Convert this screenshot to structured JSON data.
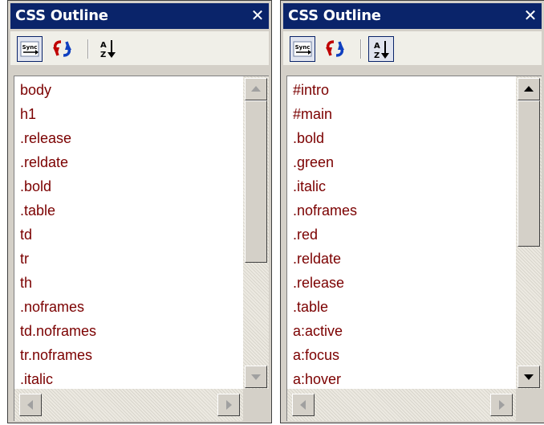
{
  "colors": {
    "title_bg": "#0a246a",
    "title_text": "#ffffff",
    "item_text": "#7b0000",
    "panel_bg": "#d4d0c8"
  },
  "icons": {
    "sync": "sync-icon",
    "refresh": "refresh-icon",
    "sort": "sort-ascending-icon",
    "close": "close-icon"
  },
  "panels": [
    {
      "title": "CSS Outline",
      "close_glyph": "✕",
      "sync_label": "Sync",
      "sort_pressed": false,
      "items": [
        "body",
        "h1",
        ".release",
        ".reldate",
        ".bold",
        ".table",
        "td",
        "tr",
        "th",
        ".noframes",
        "td.noframes",
        "tr.noframes",
        ".italic"
      ]
    },
    {
      "title": "CSS Outline",
      "close_glyph": "✕",
      "sync_label": "Sync",
      "sort_pressed": true,
      "items": [
        "#intro",
        "#main",
        ".bold",
        ".green",
        ".italic",
        ".noframes",
        ".red",
        ".reldate",
        ".release",
        ".table",
        "a:active",
        "a:focus",
        "a:hover"
      ]
    }
  ]
}
